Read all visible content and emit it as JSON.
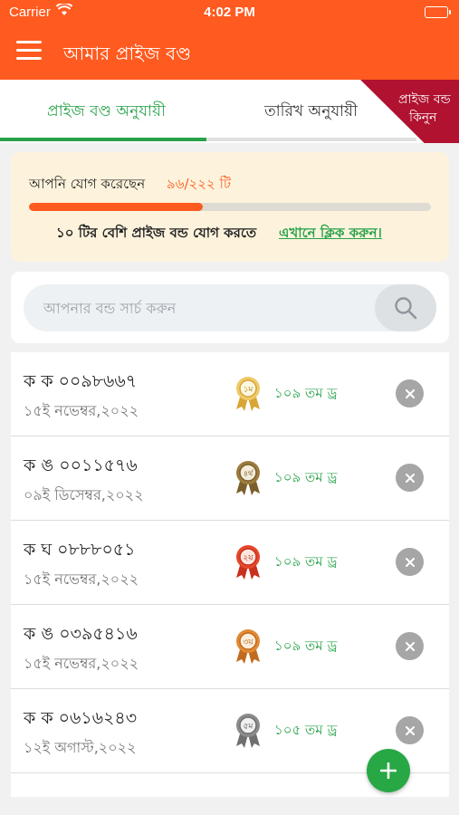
{
  "status_bar": {
    "carrier": "Carrier",
    "time": "4:02 PM"
  },
  "app_bar": {
    "title": "আমার প্রাইজ বণ্ড"
  },
  "tabs": [
    {
      "label": "প্রাইজ বণ্ড অনুযায়ী",
      "selected": true
    },
    {
      "label": "তারিখ অনুযায়ী",
      "selected": false
    }
  ],
  "buy_ribbon": {
    "line1": "প্রাইজ বন্ড",
    "line2": "কিনুন"
  },
  "progress": {
    "label": "আপনি যোগ করেছেন",
    "count_text": "৯৬/২২২ টি",
    "added": 96,
    "limit": 222,
    "note": "১০ টির বেশি প্রাইজ বন্ড যোগ করতে",
    "link": "এখানে ক্লিক করুন।"
  },
  "search": {
    "placeholder": "আপনার বন্ড সার্চ করুন",
    "value": ""
  },
  "bonds": [
    {
      "number": "ক ক ০০৯৮৬৬৭",
      "date": "১৫ই নভেম্বর,২০২২",
      "medal": "১ম",
      "medal_icon": "gold-medal-icon",
      "draw": "১০৯ তম ড্র"
    },
    {
      "number": "ক ঙ ০০১১৫৭৬",
      "date": "০৯ই ডিসেম্বর,২০২২",
      "medal": "৪র্থ",
      "medal_icon": "bronze-medal-icon",
      "draw": "১০৯ তম ড্র"
    },
    {
      "number": "ক ঘ ০৮৮৮০৫১",
      "date": "১৫ই নভেম্বর,২০২২",
      "medal": "২য়",
      "medal_icon": "red-medal-icon",
      "draw": "১০৯ তম ড্র"
    },
    {
      "number": "ক ঙ ০৩৯৫৪১৬",
      "date": "১৫ই নভেম্বর,২০২২",
      "medal": "৩য়",
      "medal_icon": "orange-medal-icon",
      "draw": "১০৯ তম ড্র"
    },
    {
      "number": "ক ক ০৬১৬২৪৩",
      "date": "১২ই অগাস্ট,২০২২",
      "medal": "৫ম",
      "medal_icon": "silver-medal-icon",
      "draw": "১০৫ তম ড্র"
    }
  ],
  "colors": {
    "primary": "#ff5a1f",
    "accent_green": "#27a249",
    "ribbon": "#b01230",
    "card_bg": "#fdf3dc"
  }
}
